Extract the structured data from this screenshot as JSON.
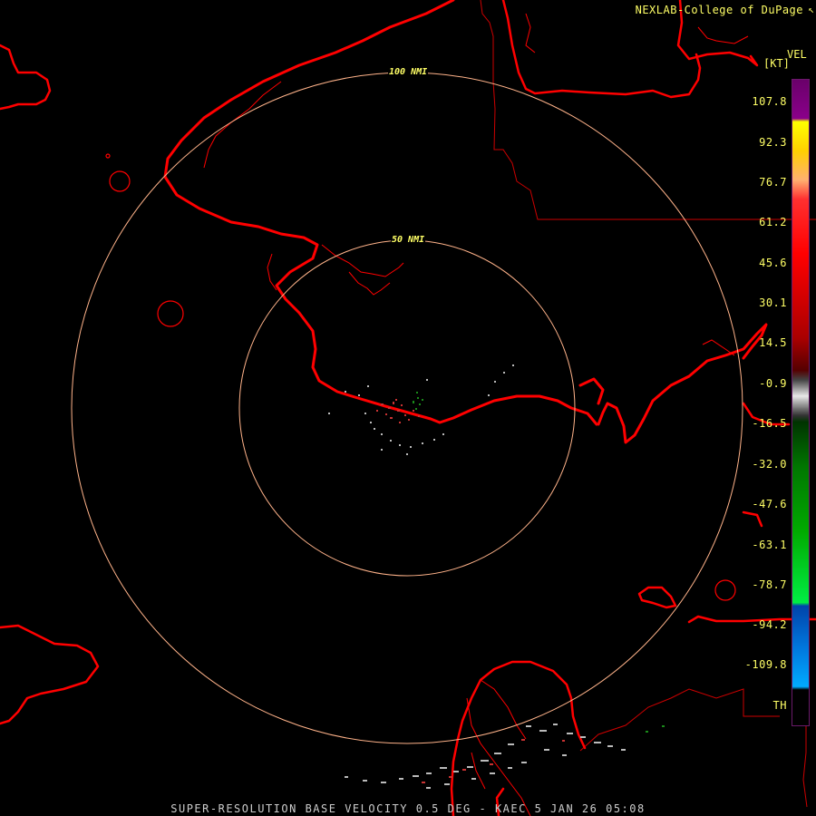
{
  "credit": "NEXLAB-College of DuPage",
  "credit_icon": "cursor-icon",
  "product": "VEL",
  "unit": "[KT]",
  "rings": [
    "50 NMI",
    "100 NMI"
  ],
  "scale_labels": [
    "107.8",
    "92.3",
    "76.7",
    "61.2",
    "45.6",
    "30.1",
    "14.5",
    "-0.9",
    "-16.5",
    "-32.0",
    "-47.6",
    "-63.1",
    "-78.7",
    "-94.2",
    "-109.8",
    "TH"
  ],
  "footer": "SUPER-RESOLUTION BASE VELOCITY 0.5 DEG - KAEC 5 JAN 26 05:08",
  "colors": {
    "coastline": "#ff0000",
    "boundary": "#cc0000",
    "range_ring": "#ffb38a",
    "label": "#ffff66",
    "colorbar_border": "#6a1a6a"
  }
}
